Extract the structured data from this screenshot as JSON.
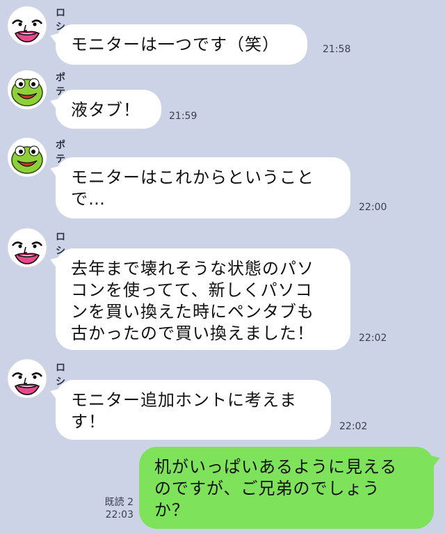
{
  "users": {
    "roshihi": {
      "name": "ロシヒ",
      "avatar_icon": "white-face-icon"
    },
    "potemame": {
      "name": "ポテ豆",
      "avatar_icon": "green-frog-icon"
    }
  },
  "messages": [
    {
      "sender": "ロシヒ",
      "lines": [
        "モニターは一つです（笑）"
      ],
      "time": "21:58"
    },
    {
      "sender": "ポテ豆",
      "lines": [
        "液タブ！"
      ],
      "time": "21:59"
    },
    {
      "sender": "ポテ豆",
      "lines": [
        "モニターはこれからということ",
        "で…"
      ],
      "time": "22:00"
    },
    {
      "sender": "ロシヒ",
      "lines": [
        "去年まで壊れそうな状態のパソ",
        "コンを使ってて、新しくパソコ",
        "ンを買い換えた時にペンタブも",
        "古かったので買い換えました！"
      ],
      "time": "22:02"
    },
    {
      "sender": "ロシヒ",
      "lines": [
        "モニター追加ホントに考えま",
        "す！"
      ],
      "time": "22:02"
    },
    {
      "sender": "me",
      "lines": [
        "机がいっぱいあるように見える",
        "のですが、ご兄弟のでしょう",
        "か？"
      ],
      "time": "22:03",
      "read_label": "既読 2"
    }
  ],
  "colors": {
    "background": "#cdd3e6",
    "incoming": "#ffffff",
    "outgoing": "#7ee35a"
  }
}
